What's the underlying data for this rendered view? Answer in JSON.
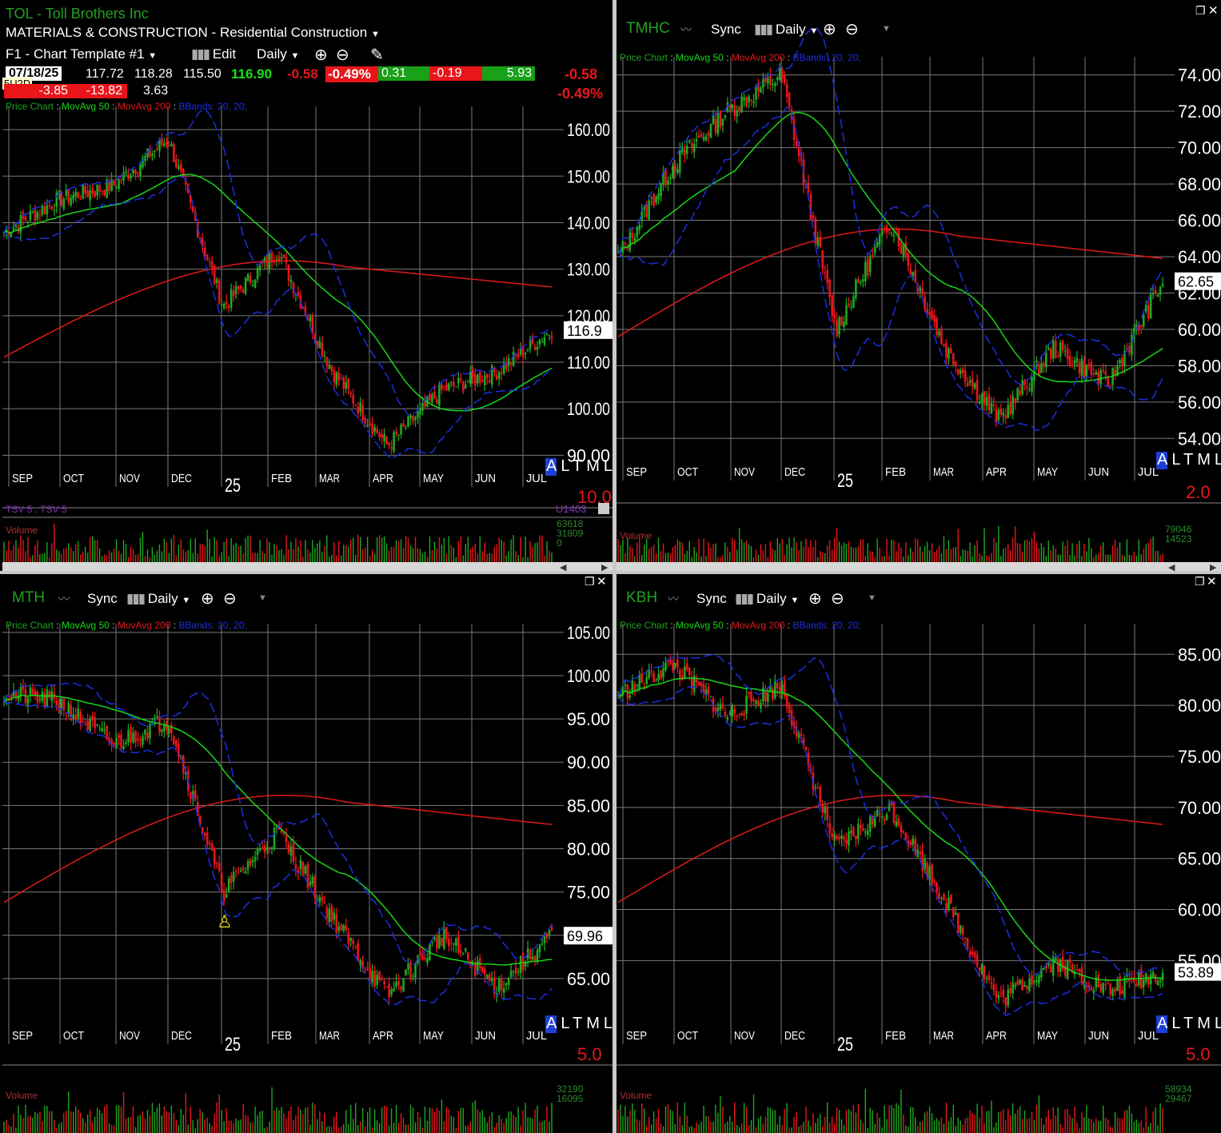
{
  "colors": {
    "up": "#1fa81f",
    "down": "#e8161b",
    "ma50": "#19d619",
    "ma200": "#e01a1a",
    "bbands": "#1b2fe0",
    "grid": "#7a7a7a",
    "symbol": "#21a021"
  },
  "months": [
    "SEP",
    "OCT",
    "NOV",
    "DEC",
    "25",
    "FEB",
    "MAR",
    "APR",
    "MAY",
    "JUN",
    "JUL"
  ],
  "indicator_labels": {
    "price": "Price Chart",
    "ma50": "MovAvg 50",
    "ma200": "MovAvg 200",
    "bb": "BBands: 20, 20;"
  },
  "atml": [
    "A",
    "L",
    "T",
    "M",
    "L"
  ],
  "toolbar": {
    "sync": "Sync",
    "daily": "Daily",
    "edit": "Edit",
    "template": "F1 - Chart Template #1"
  },
  "panes": [
    {
      "id": "tol",
      "symbol": "TOL",
      "company": "Toll Brothers Inc",
      "sector": "MATERIALS & CONSTRUCTION",
      "industry": "Residential Construction",
      "date": "07/18/25",
      "open": "117.72",
      "high": "118.28",
      "low": "115.50",
      "close": "116.90",
      "chg": "-0.58",
      "pct": "-0.49%",
      "b1": "0.31",
      "b2": "-0.19",
      "b3": "5.93",
      "r1": "-3.85",
      "r2": "-13.82",
      "r3": "3.63",
      "tag": "5U2D",
      "rchg": "-0.58",
      "rpct": "-0.49%",
      "price_label": "116.9",
      "scale": "10.0",
      "axis": [
        "160.00",
        "150.00",
        "140.00",
        "130.00",
        "120.00",
        "110.00",
        "100.00",
        "90.00"
      ],
      "tsv_label": "TSV 5 : TSV 5",
      "tsv_value": "U1403",
      "volume_label": "Volume",
      "vol": [
        "63618",
        "31809",
        "0"
      ]
    },
    {
      "id": "tmhc",
      "symbol": "TMHC",
      "price_label": "62.65",
      "scale": "2.0",
      "axis": [
        "74.00",
        "72.00",
        "70.00",
        "68.00",
        "66.00",
        "64.00",
        "62.00",
        "60.00",
        "58.00",
        "56.00",
        "54.00"
      ],
      "volume_label": "Volume",
      "vol": [
        "79046",
        "14523"
      ]
    },
    {
      "id": "mth",
      "symbol": "MTH",
      "price_label": "69.96",
      "scale": "5.0",
      "axis": [
        "105.00",
        "100.00",
        "95.00",
        "90.00",
        "85.00",
        "80.00",
        "75.00",
        "70.00",
        "65.00"
      ],
      "volume_label": "Volume",
      "vol": [
        "32190",
        "16095"
      ]
    },
    {
      "id": "kbh",
      "symbol": "KBH",
      "price_label": "53.89",
      "scale": "5.0",
      "axis": [
        "85.00",
        "80.00",
        "75.00",
        "70.00",
        "65.00",
        "60.00",
        "55.00"
      ],
      "volume_label": "Volume",
      "vol": [
        "58934",
        "29467"
      ]
    }
  ],
  "chart_data": [
    {
      "type": "line",
      "title": "TOL",
      "x": [
        "SEP",
        "OCT",
        "NOV",
        "DEC",
        "25",
        "FEB",
        "MAR",
        "APR",
        "MAY",
        "JUN",
        "JUL"
      ],
      "series": [
        {
          "values": [
            138,
            145,
            148,
            158,
            122,
            134,
            108,
            92,
            104,
            108,
            116.9
          ]
        }
      ],
      "ylim": [
        88,
        165
      ]
    },
    {
      "type": "line",
      "title": "TMHC",
      "x": [
        "SEP",
        "OCT",
        "NOV",
        "DEC",
        "25",
        "FEB",
        "MAR",
        "APR",
        "MAY",
        "JUN",
        "JUL"
      ],
      "series": [
        {
          "values": [
            64,
            69,
            72,
            74,
            60,
            66,
            59,
            55,
            59,
            57,
            62.65
          ]
        }
      ],
      "ylim": [
        53,
        75
      ]
    },
    {
      "type": "line",
      "title": "MTH",
      "x": [
        "SEP",
        "OCT",
        "NOV",
        "DEC",
        "25",
        "FEB",
        "MAR",
        "APR",
        "MAY",
        "JUN",
        "JUL"
      ],
      "series": [
        {
          "values": [
            98,
            97,
            92,
            95,
            75,
            82,
            72,
            63,
            70,
            64,
            69.96
          ]
        }
      ],
      "ylim": [
        60,
        106
      ]
    },
    {
      "type": "line",
      "title": "KBH",
      "x": [
        "SEP",
        "OCT",
        "NOV",
        "DEC",
        "25",
        "FEB",
        "MAR",
        "APR",
        "MAY",
        "JUN",
        "JUL"
      ],
      "series": [
        {
          "values": [
            81,
            84,
            79,
            82,
            66,
            70,
            61,
            51,
            55,
            52,
            53.89
          ]
        }
      ],
      "ylim": [
        49,
        88
      ]
    }
  ]
}
